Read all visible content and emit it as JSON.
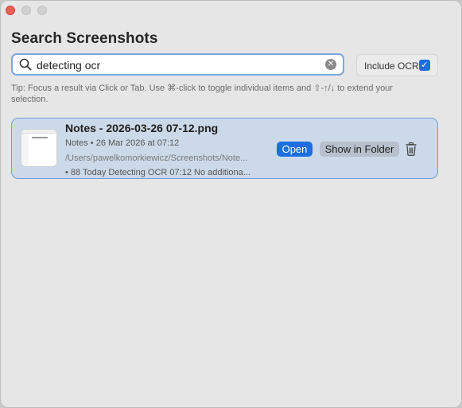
{
  "window": {
    "title": "Search Screenshots"
  },
  "search": {
    "value": "detecting ocr",
    "clear_symbol": "✕"
  },
  "ocr_toggle": {
    "label": "Include OCR",
    "checked": true,
    "check_symbol": "✓"
  },
  "tip": "Tip: Focus a result via Click or Tab. Use ⌘-click to toggle individual items and ⇧-↑/↓ to extend your selection.",
  "results": [
    {
      "filename": "Notes - 2026-03-26 07-12.png",
      "meta": "Notes • 26 Mar 2026 at 07:12",
      "path": "/Users/pawelkomorkiewicz/Screenshots/Note...",
      "ocr_snippet": "• 88 Today Detecting OCR 07:12 No additiona...",
      "open_label": "Open",
      "show_in_folder_label": "Show in Folder",
      "thumbnail_icon": "screenshot-thumbnail",
      "trash_icon": "trash-icon"
    }
  ],
  "colors": {
    "accent": "#1b6fe0",
    "selection": "#ccd9e9",
    "selection_border": "#6f9ed8",
    "window_bg": "#e6e6e6",
    "close": "#ee5f57"
  }
}
